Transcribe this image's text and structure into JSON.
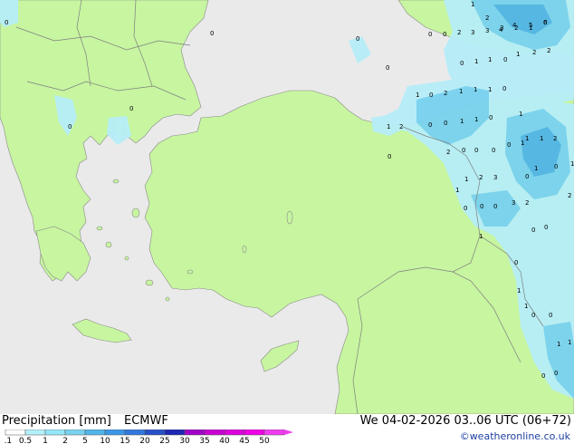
{
  "header": {
    "title": "Precipitation [mm]",
    "model": "ECMWF",
    "datetime": "We 04-02-2026 03..06 UTC (06+72)",
    "credit": "©weatheronline.co.uk"
  },
  "legend": {
    "labels": [
      "0.1",
      "0.5",
      "1",
      "2",
      "5",
      "10",
      "15",
      "20",
      "25",
      "30",
      "35",
      "40",
      "45",
      "50"
    ],
    "colors": [
      "#ffffff",
      "#b4f0fa",
      "#96e6fa",
      "#78d2f0",
      "#50b4e6",
      "#3c96e6",
      "#3278dc",
      "#2850c8",
      "#1e28b4",
      "#a000c8",
      "#c800d2",
      "#dc00dc",
      "#f000e6",
      "#f03cf0"
    ]
  },
  "colors": {
    "sea": "#eaeaea",
    "land": "#c7f5a0",
    "rain_light": "#b6eef8",
    "rain_moderate": "#78d2f0",
    "rain_heavy": "#50b4e6"
  },
  "map_values": [
    "0",
    "1",
    "2",
    "3",
    "4",
    "5",
    "6",
    "0",
    "0",
    "0",
    "0",
    "2",
    "3",
    "3",
    "4",
    "2",
    "1",
    "0",
    "0",
    "0",
    "1",
    "1",
    "0",
    "1",
    "2",
    "2",
    "0",
    "1",
    "2",
    "1",
    "1",
    "1",
    "0",
    "0",
    "1",
    "0",
    "0",
    "0",
    "1",
    "1",
    "0",
    "1",
    "2",
    "1",
    "1",
    "2",
    "2",
    "0",
    "0",
    "0",
    "0",
    "1",
    "1",
    "0",
    "1",
    "0",
    "1",
    "2",
    "3",
    "0",
    "1",
    "2",
    "0",
    "0",
    "3",
    "2",
    "0",
    "0",
    "0",
    "1",
    "0",
    "1",
    "1",
    "0",
    "0",
    "1",
    "1",
    "0",
    "0"
  ]
}
